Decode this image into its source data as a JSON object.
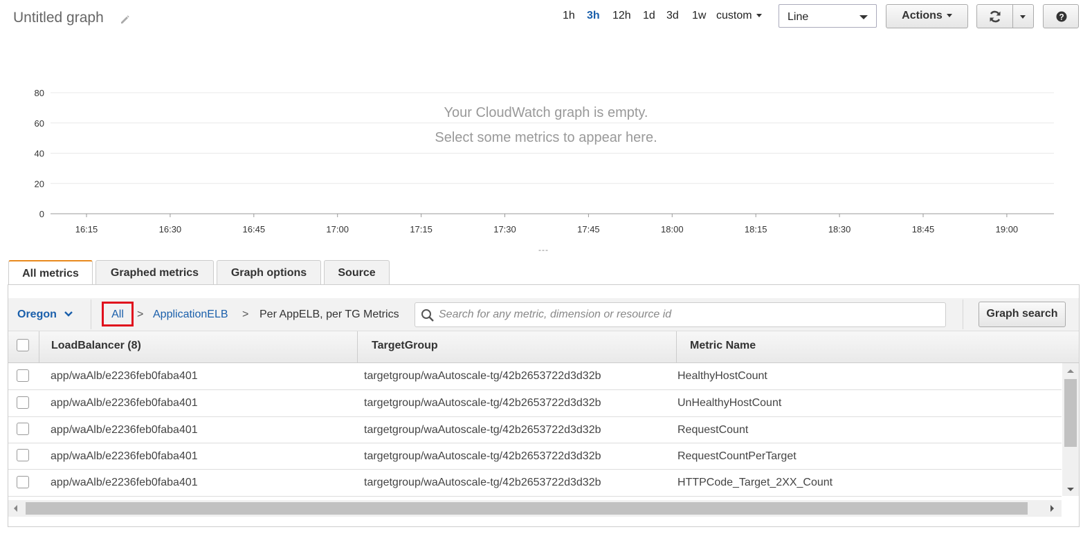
{
  "header": {
    "title": "Untitled graph",
    "time_ranges": [
      {
        "label": "1h",
        "active": false
      },
      {
        "label": "3h",
        "active": true
      },
      {
        "label": "12h",
        "active": false
      },
      {
        "label": "1d",
        "active": false
      },
      {
        "label": "3d",
        "active": false
      },
      {
        "label": "1w",
        "active": false
      }
    ],
    "custom_label": "custom",
    "graph_type": "Line",
    "actions_label": "Actions"
  },
  "chart": {
    "empty_line1": "Your CloudWatch graph is empty.",
    "empty_line2": "Select some metrics to appear here.",
    "y_ticks": [
      "80",
      "60",
      "40",
      "20",
      "0"
    ],
    "x_ticks": [
      "16:15",
      "16:30",
      "16:45",
      "17:00",
      "17:15",
      "17:30",
      "17:45",
      "18:00",
      "18:15",
      "18:30",
      "18:45",
      "19:00"
    ],
    "resize_handle": "---"
  },
  "tabs": [
    "All metrics",
    "Graphed metrics",
    "Graph options",
    "Source"
  ],
  "filter": {
    "region": "Oregon",
    "crumbs": [
      "All",
      "ApplicationELB",
      "Per AppELB, per TG Metrics"
    ],
    "crumb_sep": ">",
    "search_placeholder": "Search for any metric, dimension or resource id",
    "graph_search_label": "Graph search"
  },
  "table": {
    "headers": [
      "LoadBalancer (8)",
      "TargetGroup",
      "Metric Name"
    ],
    "rows": [
      [
        "app/waAlb/e2236feb0faba401",
        "targetgroup/waAutoscale-tg/42b2653722d3d32b",
        "HealthyHostCount"
      ],
      [
        "app/waAlb/e2236feb0faba401",
        "targetgroup/waAutoscale-tg/42b2653722d3d32b",
        "UnHealthyHostCount"
      ],
      [
        "app/waAlb/e2236feb0faba401",
        "targetgroup/waAutoscale-tg/42b2653722d3d32b",
        "RequestCount"
      ],
      [
        "app/waAlb/e2236feb0faba401",
        "targetgroup/waAutoscale-tg/42b2653722d3d32b",
        "RequestCountPerTarget"
      ],
      [
        "app/waAlb/e2236feb0faba401",
        "targetgroup/waAutoscale-tg/42b2653722d3d32b",
        "HTTPCode_Target_2XX_Count"
      ]
    ]
  },
  "icons": {
    "edit": "pencil-icon",
    "refresh": "refresh-icon",
    "help": "help-icon",
    "search": "search-icon",
    "region_chevron": "chevron-down-icon"
  },
  "colors": {
    "link": "#1a5fab",
    "active_tab_accent": "#e8891d",
    "highlight_box": "#e0101d"
  }
}
